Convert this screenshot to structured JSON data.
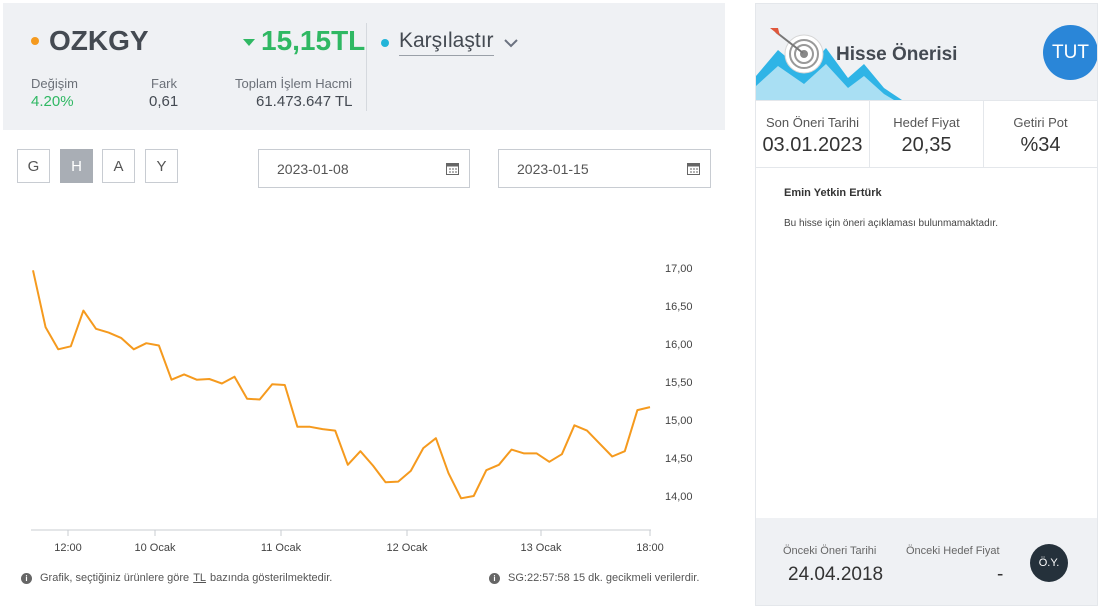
{
  "stock": {
    "symbol": "OZKGY",
    "price": "15,15TL",
    "compare_label": "Karşılaştır",
    "change_label": "Değişim",
    "change_value": "4.20%",
    "diff_label": "Fark",
    "diff_value": "0,61",
    "volume_label": "Toplam İşlem Hacmi",
    "volume_value": "61.473.647 TL"
  },
  "periods": [
    {
      "label": "G",
      "active": false
    },
    {
      "label": "H",
      "active": true
    },
    {
      "label": "A",
      "active": false
    },
    {
      "label": "Y",
      "active": false
    }
  ],
  "date_from": "2023-01-08",
  "date_to": "2023-01-15",
  "colors": {
    "line": "#f59a1e",
    "positive": "#2fb863",
    "accent_blue": "#2a86d8"
  },
  "chart_data": {
    "type": "line",
    "x_ticks": [
      "12:00",
      "10 Ocak",
      "11 Ocak",
      "12 Ocak",
      "13 Ocak",
      "18:00"
    ],
    "y_ticks": [
      "17,00",
      "16,50",
      "16,00",
      "15,50",
      "15,00",
      "14,50",
      "14,00"
    ],
    "ylim": [
      13.5,
      17.2
    ],
    "series": [
      {
        "values": [
          16.97,
          16.22,
          15.93,
          15.97,
          16.44,
          16.2,
          16.15,
          16.08,
          15.93,
          16.01,
          15.98,
          15.53,
          15.6,
          15.53,
          15.54,
          15.48,
          15.57,
          15.28,
          15.27,
          15.47,
          15.46,
          14.91,
          14.91,
          14.88,
          14.86,
          14.41,
          14.59,
          14.4,
          14.18,
          14.19,
          14.33,
          14.63,
          14.76,
          14.3,
          13.97,
          14.0,
          14.34,
          14.41,
          14.61,
          14.56,
          14.56,
          14.45,
          14.55,
          14.93,
          14.86,
          14.69,
          14.52,
          14.59,
          15.13,
          15.17
        ]
      }
    ]
  },
  "notes": {
    "left_prefix": "Grafik, seçtiğiniz ürünlere göre",
    "left_tl": "TL",
    "left_suffix": "bazında gösterilmektedir.",
    "right": "SG:22:57:58 15 dk. gecikmeli verilerdir."
  },
  "recommendation": {
    "title": "Hisse Önerisi",
    "badge": "TUT",
    "last_date_label": "Son Öneri Tarihi",
    "last_date_value": "03.01.2023",
    "target_label": "Hedef Fiyat",
    "target_value": "20,35",
    "return_label": "Getiri Pot",
    "return_value": "%34",
    "author": "Emin Yetkin Ertürk",
    "description": "Bu hisse için öneri açıklaması bulunmamaktadır.",
    "prev_date_label": "Önceki Öneri Tarihi",
    "prev_date_value": "24.04.2018",
    "prev_target_label": "Önceki Hedef Fiyat",
    "prev_target_value": "-",
    "prev_badge": "Ö.Y."
  }
}
